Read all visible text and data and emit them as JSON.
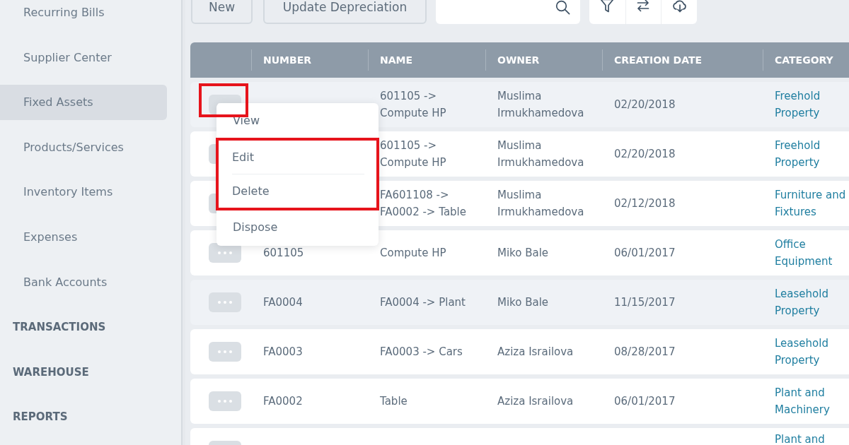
{
  "sidebar": {
    "items": [
      {
        "kind": "item",
        "label": "Recurring Bills",
        "selected": false
      },
      {
        "kind": "item",
        "label": "Supplier Center",
        "selected": false
      },
      {
        "kind": "item",
        "label": "Fixed Assets",
        "selected": true
      },
      {
        "kind": "item",
        "label": "Products/Services",
        "selected": false
      },
      {
        "kind": "item",
        "label": "Inventory Items",
        "selected": false
      },
      {
        "kind": "item",
        "label": "Expenses",
        "selected": false
      },
      {
        "kind": "item",
        "label": "Bank Accounts",
        "selected": false
      },
      {
        "kind": "section",
        "label": "TRANSACTIONS",
        "selected": false
      },
      {
        "kind": "section",
        "label": "WAREHOUSE",
        "selected": false
      },
      {
        "kind": "section",
        "label": "REPORTS",
        "selected": false
      }
    ]
  },
  "toolbar": {
    "buttons": [
      {
        "label": "New"
      },
      {
        "label": "Update Depreciation"
      }
    ]
  },
  "table": {
    "columns": [
      "NUMBER",
      "NAME",
      "OWNER",
      "CREATION DATE",
      "CATEGORY"
    ],
    "rows": [
      {
        "name": "601105 -> Compute HP",
        "owner": "Muslima Irmukhamedova",
        "creation_date": "02/20/2018",
        "category": "Freehold Property",
        "highlighted": true,
        "menu_open": true,
        "annotated": true
      },
      {
        "name": "601105 -> Compute HP",
        "owner": "Muslima Irmukhamedova",
        "creation_date": "02/20/2018",
        "category": "Freehold Property",
        "highlighted": false,
        "menu_open": false,
        "annotated": false
      },
      {
        "name": "FA601108 -> FA0002 -> Table",
        "owner": "Muslima Irmukhamedova",
        "creation_date": "02/12/2018",
        "category": "Furniture and Fixtures",
        "highlighted": false,
        "menu_open": false,
        "annotated": false
      },
      {
        "number": "601105",
        "name": "Compute HP",
        "owner": "Miko Bale",
        "creation_date": "06/01/2017",
        "category": "Office Equipment",
        "highlighted": false,
        "menu_open": false,
        "annotated": false
      },
      {
        "number": "FA0004",
        "name": "FA0004 -> Plant",
        "owner": "Miko Bale",
        "creation_date": "11/15/2017",
        "category": "Leasehold Property",
        "highlighted": true,
        "menu_open": false,
        "annotated": false
      },
      {
        "number": "FA0003",
        "name": "FA0003 -> Cars",
        "owner": "Aziza Israilova",
        "creation_date": "08/28/2017",
        "category": "Leasehold Property",
        "highlighted": false,
        "menu_open": false,
        "annotated": false
      },
      {
        "number": "FA0002",
        "name": "Table",
        "owner": "Aziza Israilova",
        "creation_date": "06/01/2017",
        "category": "Plant and Machinery",
        "highlighted": false,
        "menu_open": false,
        "annotated": false
      },
      {
        "category": "Plant and",
        "highlighted": false,
        "menu_open": false,
        "annotated": false
      }
    ]
  },
  "action_menu": {
    "items": [
      {
        "label": "View",
        "annotated": false
      },
      {
        "label": "Edit",
        "annotated": true
      },
      {
        "label": "Delete",
        "annotated": true
      },
      {
        "label": "Dispose",
        "annotated": false
      }
    ]
  }
}
